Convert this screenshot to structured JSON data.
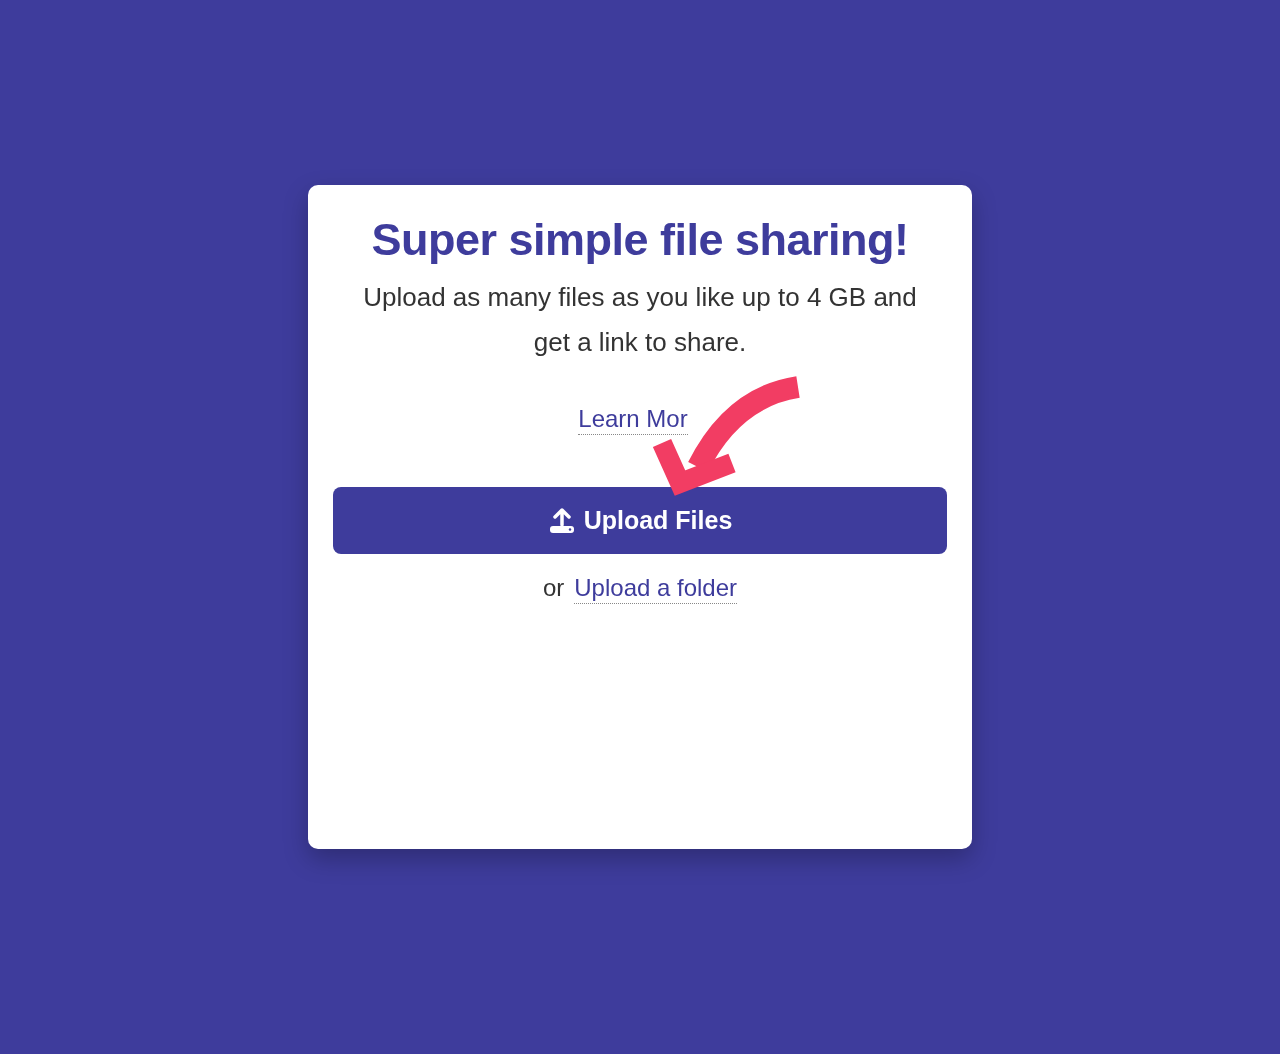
{
  "title": "Super simple file sharing!",
  "subtitle": "Upload as many files as you like up to 4 GB and get a link to share.",
  "learn_more": {
    "label": "Learn Mor"
  },
  "upload_button": {
    "label": "Upload Files"
  },
  "alternative": {
    "prefix": "or",
    "link": "Upload a folder"
  }
}
